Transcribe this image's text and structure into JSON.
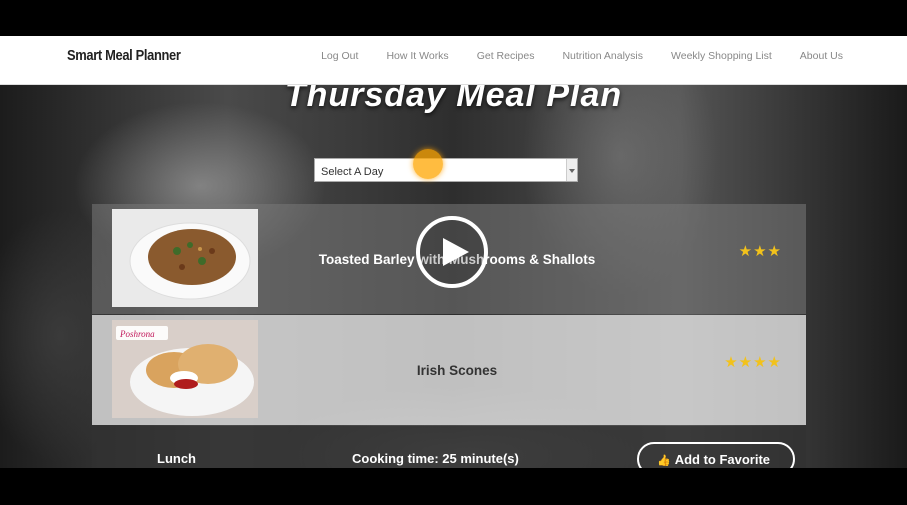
{
  "navbar": {
    "brand": "Smart Meal Planner",
    "links": [
      "Log Out",
      "How It Works",
      "Get Recipes",
      "Nutrition Analysis",
      "Weekly Shopping List",
      "About Us"
    ]
  },
  "page": {
    "title": "Thursday Meal Plan",
    "day_select": {
      "selected": "Select A Day"
    }
  },
  "meals": [
    {
      "name": "Toasted Barley with Mushrooms & Shallots",
      "rating": 3,
      "rating_display": "★★★"
    },
    {
      "name": "Irish Scones",
      "rating": 4,
      "rating_display": "★★★★"
    }
  ],
  "meal_detail": {
    "meal_type": "Lunch",
    "cooking_time": "Cooking time: 25 minute(s)",
    "favorite_label": "Add to Favorite"
  },
  "thumb2_caption": "Poshrona",
  "colors": {
    "star": "#f2c21b",
    "cursor_highlight": "#ffa500"
  },
  "video": {
    "play_icon": "play-icon"
  }
}
